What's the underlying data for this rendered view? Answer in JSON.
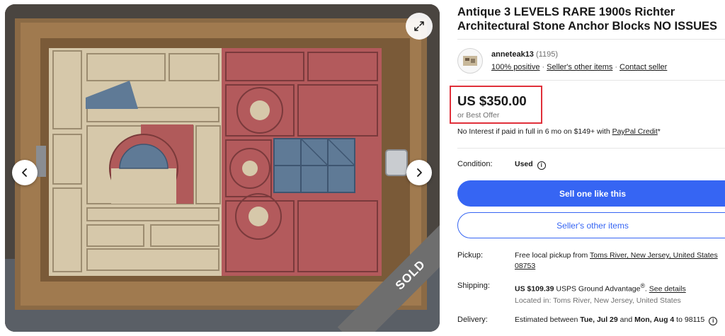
{
  "listing": {
    "title": "Antique 3 LEVELS RARE 1900s Richter Architectural Stone Anchor Blocks NO ISSUES",
    "sold_badge": "SOLD"
  },
  "seller": {
    "name": "anneteak13",
    "feedback_count": "(1195)",
    "positive": "100% positive",
    "other_items_link": "Seller's other items",
    "contact_link": "Contact seller",
    "separator": "·"
  },
  "price": {
    "amount": "US $350.00",
    "best_offer": "or Best Offer",
    "financing_text": "No Interest if paid in full in 6 mo on $149+ with ",
    "financing_link": "PayPal Credit",
    "financing_suffix": "*",
    "highlight_color": "#e0303a"
  },
  "condition": {
    "label": "Condition:",
    "value": "Used",
    "info_icon": "i"
  },
  "buttons": {
    "sell_one": "Sell one like this",
    "seller_items": "Seller's other items",
    "primary_color": "#3665f3"
  },
  "pickup": {
    "label": "Pickup:",
    "text": "Free local pickup from ",
    "location_link_1": "Toms River, New Jersey, United States",
    "location_link_2": "08753"
  },
  "shipping": {
    "label": "Shipping:",
    "cost": "US $109.39",
    "service": " USPS Ground Advantage",
    "reg": "®",
    "dot": ". ",
    "details_link": "See details",
    "location": "Located in: Toms River, New Jersey, United States"
  },
  "delivery": {
    "label": "Delivery:",
    "prefix": "Estimated between ",
    "start": "Tue, Jul 29",
    "and": " and ",
    "end": "Mon, Aug 4",
    "suffix": " to 98115"
  },
  "icons": {
    "prev": "chevron-left-icon",
    "next": "chevron-right-icon",
    "expand": "expand-icon",
    "info": "info-icon"
  }
}
